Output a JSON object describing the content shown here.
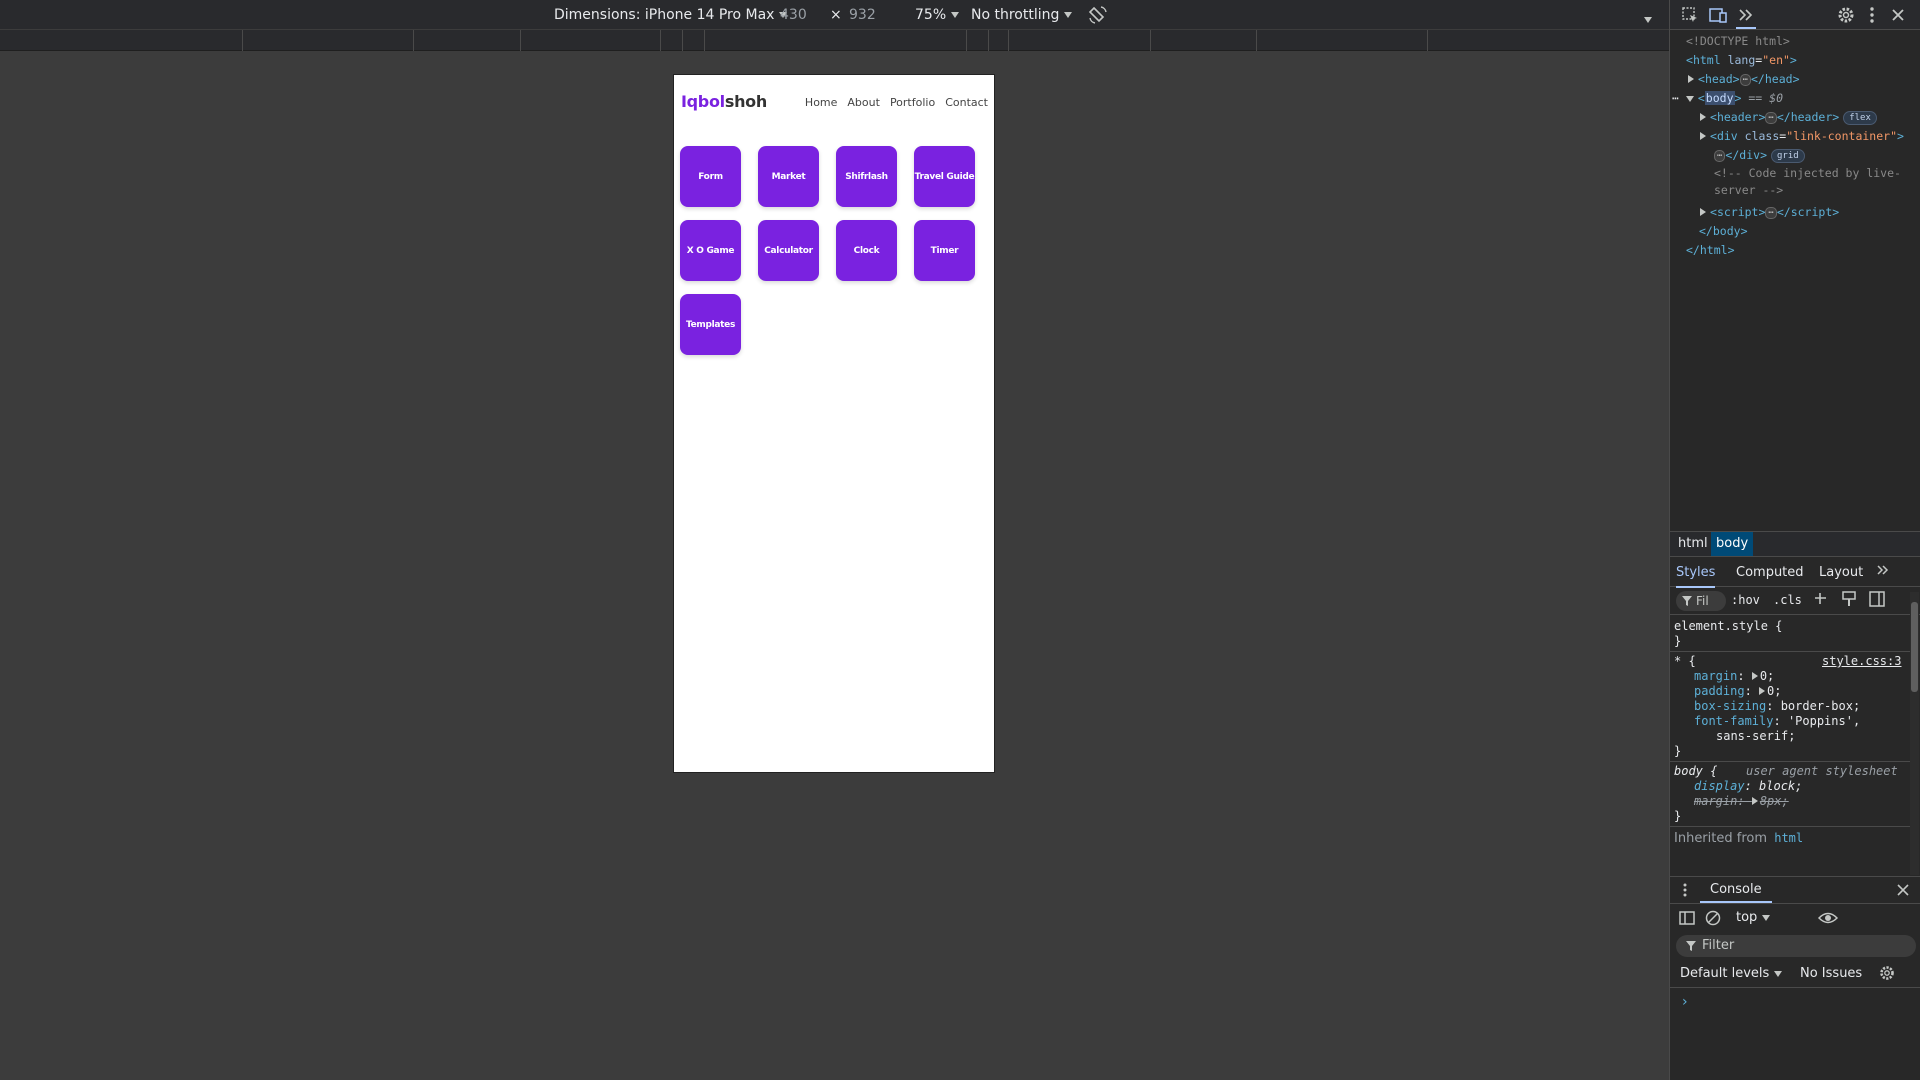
{
  "device_toolbar": {
    "dimensions_label": "Dimensions: iPhone 14 Pro Max",
    "width": "430",
    "times": "×",
    "height": "932",
    "zoom": "75%",
    "throttling": "No throttling"
  },
  "page": {
    "logo_accent": "Iqbol",
    "logo_rest": "shoh",
    "nav": [
      "Home",
      "About",
      "Portfolio",
      "Contact"
    ],
    "tiles": [
      "Form",
      "Market",
      "Shifrlash",
      "Travel Guide",
      "X O Game",
      "Calculator",
      "Clock",
      "Timer",
      "Templates"
    ],
    "accent_color": "#7a22e0"
  },
  "elements_panel": {
    "doctype": "<!DOCTYPE html>",
    "html_open": "html",
    "html_attr": "lang",
    "html_attr_value": "\"en\"",
    "head": "head",
    "body": "body",
    "body_suffix": "== $0",
    "header": "header",
    "header_badge": "flex",
    "div": "div",
    "div_attr": "class",
    "div_attr_value": "\"link-container\"",
    "div_badge": "grid",
    "comment": "<!-- Code injected by live-server -->",
    "script": "script",
    "ellipsis": "⋯"
  },
  "breadcrumb": [
    "html",
    "body"
  ],
  "styles_tabs": [
    "Styles",
    "Computed",
    "Layout"
  ],
  "styles_filter": {
    "placeholder": "Fil",
    "hov": ":hov",
    "cls": ".cls"
  },
  "rules": {
    "element_style": "element.style {",
    "close": "}",
    "universal_selector": "* {",
    "universal_source": "style.css:3",
    "margin_prop": "margin",
    "margin_val": "0;",
    "padding_prop": "padding",
    "padding_val": "0;",
    "box_sizing_prop": "box-sizing",
    "box_sizing_val": "border-box;",
    "font_family_prop": "font-family",
    "font_family_val1": "'Poppins',",
    "font_family_val2": "sans-serif;",
    "body_selector": "body {",
    "ua_label": "user agent stylesheet",
    "display_prop": "display",
    "display_val": "block;",
    "body_margin_prop": "margin",
    "body_margin_val": "8px;",
    "inherited_from": "Inherited from",
    "inherited_link": "html"
  },
  "console": {
    "tab": "Console",
    "context": "top",
    "filter_placeholder": "Filter",
    "levels": "Default levels",
    "issues": "No Issues",
    "prompt": "›"
  }
}
